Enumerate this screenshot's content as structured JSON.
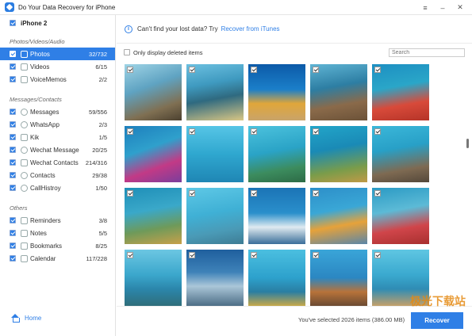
{
  "app": {
    "title": "Do Your Data Recovery for iPhone",
    "controls": [
      "≡",
      "–",
      "✕"
    ]
  },
  "device": {
    "name": "iPhone 2"
  },
  "sidebar": {
    "sections": [
      {
        "title": "Photos/Videos/Audio",
        "items": [
          {
            "label": "Photos",
            "count": "32/732",
            "icon": "photo-icon",
            "active": true
          },
          {
            "label": "Videos",
            "count": "6/15",
            "icon": "video-icon",
            "active": false
          },
          {
            "label": "VoiceMemos",
            "count": "2/2",
            "icon": "voice-memo-icon",
            "active": false
          }
        ]
      },
      {
        "title": "Messages/Contacts",
        "items": [
          {
            "label": "Messages",
            "count": "59/556",
            "icon": "message-icon",
            "active": false
          },
          {
            "label": "WhatsApp",
            "count": "2/3",
            "icon": "whatsapp-icon",
            "active": false
          },
          {
            "label": "Kik",
            "count": "1/5",
            "icon": "kik-icon",
            "active": false
          },
          {
            "label": "Wechat Message",
            "count": "20/25",
            "icon": "wechat-icon",
            "active": false
          },
          {
            "label": "Wechat Contacts",
            "count": "214/316",
            "icon": "wechat-contacts-icon",
            "active": false
          },
          {
            "label": "Contacts",
            "count": "29/38",
            "icon": "contacts-icon",
            "active": false
          },
          {
            "label": "CallHistroy",
            "count": "1/50",
            "icon": "phone-icon",
            "active": false
          }
        ]
      },
      {
        "title": "Others",
        "items": [
          {
            "label": "Reminders",
            "count": "3/8",
            "icon": "reminder-icon",
            "active": false
          },
          {
            "label": "Notes",
            "count": "5/5",
            "icon": "notes-icon",
            "active": false
          },
          {
            "label": "Bookmarks",
            "count": "8/25",
            "icon": "bookmark-icon",
            "active": false
          },
          {
            "label": "Calendar",
            "count": "117/228",
            "icon": "calendar-icon",
            "active": false
          }
        ]
      }
    ],
    "home_label": "Home"
  },
  "info_bar": {
    "text": "Can't find your lost data? Try",
    "link": "Recover from iTunes"
  },
  "filter": {
    "only_deleted_label": "Only display deleted items",
    "search_placeholder": "Search"
  },
  "footer": {
    "selected_text": "You've selected 2026 items (386.00 MB)",
    "recover_label": "Recover"
  },
  "watermark": "极光下载站",
  "photos": [
    {
      "bg": "linear-gradient(160deg,#9fd4e6 0%,#5fa3c2 40%,#7f6f52 75%,#4c4130 100%)"
    },
    {
      "bg": "linear-gradient(170deg,#6cc0e0 0%,#3f9ac0 35%,#2f6a80 60%,#d9c784 100%)"
    },
    {
      "bg": "linear-gradient(180deg,#0c5aa8 0%,#1b7fc9 45%,#e0a63a 70%,#c9a46a 100%)"
    },
    {
      "bg": "linear-gradient(170deg,#5fb4d4 0%,#2d7ea3 40%,#8a6a4a 70%,#6b5238 100%)"
    },
    {
      "bg": "linear-gradient(170deg,#1d8fc2 0%,#2aa6c8 40%,#d84a3a 70%,#b53428 100%)"
    },
    {
      "bg": "linear-gradient(160deg,#1d7fbd 0%,#2fa0cc 40%,#c23a86 70%,#7a3e9c 100%)"
    },
    {
      "bg": "linear-gradient(180deg,#56c5e6 0%,#2fa7cf 50%,#1f86b4 100%)"
    },
    {
      "bg": "linear-gradient(170deg,#4cc2dd 0%,#2aa3c6 45%,#3c8c5e 75%,#2d6b46 100%)"
    },
    {
      "bg": "linear-gradient(170deg,#22a5c9 0%,#1a8ab6 40%,#7a9c4a 75%,#c09a46 100%)"
    },
    {
      "bg": "linear-gradient(170deg,#3bb7d9 0%,#28a0c7 40%,#7e6a52 75%,#54483a 100%)"
    },
    {
      "bg": "linear-gradient(170deg,#1f8fb8 0%,#3aa8c9 40%,#6e9a5a 70%,#c7a04a 100%)"
    },
    {
      "bg": "linear-gradient(170deg,#5ec8e6 0%,#3fb0d5 45%,#4a9ab6 75%,#3e7c94 100%)"
    },
    {
      "bg": "linear-gradient(180deg,#1b74b6 0%,#2a8fcb 45%,#dfeaf0 70%,#3a6e9a 100%)"
    },
    {
      "bg": "linear-gradient(170deg,#2d8fc9 0%,#3aa7d6 40%,#e6a23a 65%,#5a86a8 100%)"
    },
    {
      "bg": "linear-gradient(170deg,#2b9ac4 0%,#5cbad6 40%,#d0454a 70%,#a8302f 100%)"
    },
    {
      "bg": "linear-gradient(180deg,#6cc7e2 0%,#3ba7cc 45%,#2b86ab 70%,#2f6e7a 100%)"
    },
    {
      "bg": "linear-gradient(180deg,#1f5f9e 0%,#3e82b8 40%,#aac6d8 65%,#4d6e86 100%)"
    },
    {
      "bg": "linear-gradient(180deg,#4bbfe0 0%,#2da1cc 50%,#2a7ea2 75%,#c7a94a 100%)"
    },
    {
      "bg": "linear-gradient(180deg,#3aa5d8 0%,#2b87c2 50%,#b8733a 75%,#6b4a32 100%)"
    },
    {
      "bg": "linear-gradient(180deg,#5fc6e2 0%,#3aa9cf 45%,#2f8cb4 70%,#c4a06a 100%)"
    }
  ]
}
